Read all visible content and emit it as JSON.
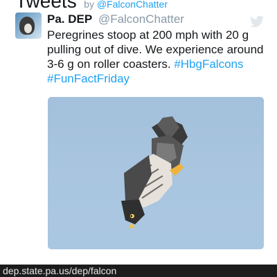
{
  "header": {
    "title": "Tweets",
    "by": "by",
    "handle": "@FalconChatter"
  },
  "tweet": {
    "author": "Pa. DEP",
    "handle": "@FalconChatter",
    "text_prefix": "Peregrines stoop at 200 mph with 20 g pulling out of dive.  We experience around 3-6 g on roller coasters.",
    "hashtags": [
      "#HbgFalcons",
      "#FunFactFriday"
    ],
    "media_alt": "Peregrine falcon diving"
  },
  "footer": {
    "url": "dep.state.pa.us/dep/falcon"
  },
  "colors": {
    "link": "#1da1f2",
    "text": "#14171a",
    "muted": "#8899a6",
    "footer_bg": "#1c1c1c"
  }
}
